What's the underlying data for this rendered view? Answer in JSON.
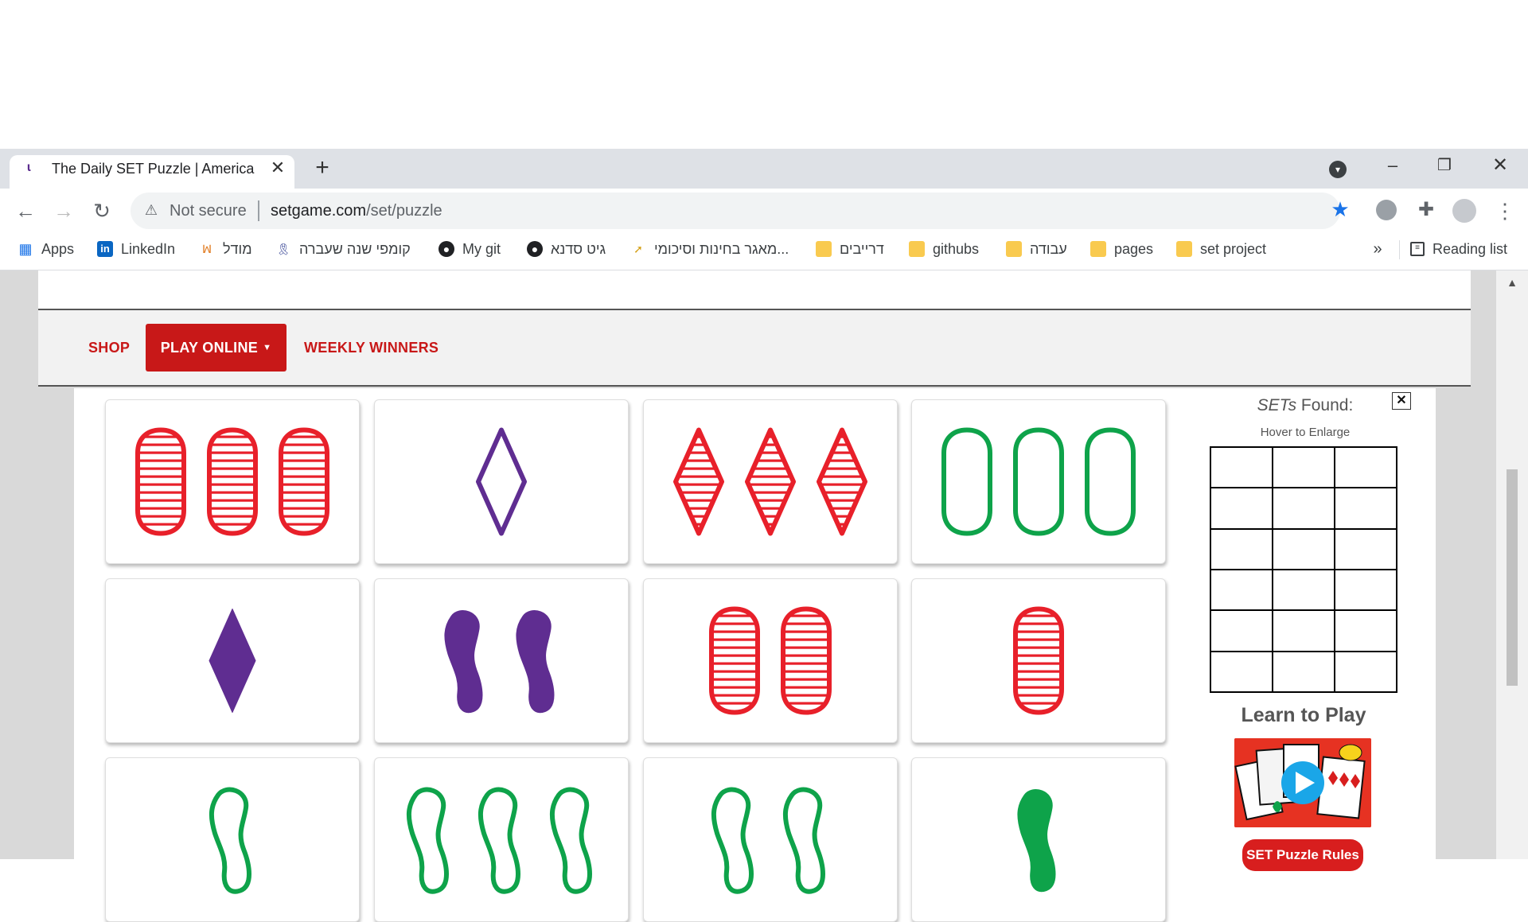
{
  "browser": {
    "tab_title": "The Daily SET Puzzle | America's F",
    "not_secure": "Not secure",
    "url_host": "setgame.com",
    "url_path": "/set/puzzle"
  },
  "bookmarks": {
    "apps": "Apps",
    "linkedin": "LinkedIn",
    "model": "מודל",
    "kumpi": "קומפי שנה שעברה",
    "mygit": "My git",
    "gitsadna": "גיט סדנא",
    "exams": "מאגר בחינות וסיכומי...",
    "drivers": "דרייבים",
    "githubs": "githubs",
    "work": "עבודה",
    "pages": "pages",
    "setproject": "set project",
    "reading_list": "Reading list"
  },
  "nav": {
    "shop": "SHOP",
    "play_online": "PLAY ONLINE",
    "weekly_winners": "WEEKLY WINNERS"
  },
  "side": {
    "sets_found_em": "SETs",
    "sets_found_rest": " Found:",
    "close": "✕",
    "hover_hint": "Hover to Enlarge",
    "learn_title": "Learn to Play",
    "rules_button": "SET Puzzle Rules"
  },
  "colors": {
    "red": "#e8202a",
    "purple": "#5f2d91",
    "green": "#0ea34a",
    "nav_red": "#c81818"
  },
  "cards": [
    {
      "number": 3,
      "shape": "oval",
      "color": "red",
      "shading": "striped"
    },
    {
      "number": 1,
      "shape": "diamond",
      "color": "purple",
      "shading": "open"
    },
    {
      "number": 3,
      "shape": "diamond",
      "color": "red",
      "shading": "striped"
    },
    {
      "number": 3,
      "shape": "oval",
      "color": "green",
      "shading": "open"
    },
    {
      "number": 1,
      "shape": "diamond",
      "color": "purple",
      "shading": "solid"
    },
    {
      "number": 2,
      "shape": "squiggle",
      "color": "purple",
      "shading": "solid"
    },
    {
      "number": 2,
      "shape": "oval",
      "color": "red",
      "shading": "striped"
    },
    {
      "number": 1,
      "shape": "oval",
      "color": "red",
      "shading": "striped"
    },
    {
      "number": 1,
      "shape": "squiggle",
      "color": "green",
      "shading": "open"
    },
    {
      "number": 3,
      "shape": "squiggle",
      "color": "green",
      "shading": "open"
    },
    {
      "number": 2,
      "shape": "squiggle",
      "color": "green",
      "shading": "open"
    },
    {
      "number": 1,
      "shape": "squiggle",
      "color": "green",
      "shading": "solid"
    }
  ]
}
